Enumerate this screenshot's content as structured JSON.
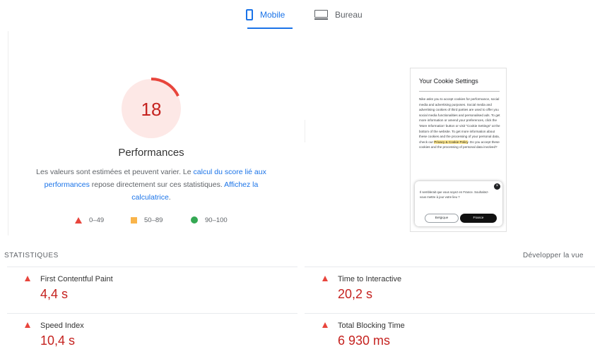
{
  "tabs": {
    "mobile": {
      "label": "Mobile",
      "icon": "phone-icon",
      "active": true
    },
    "desktop": {
      "label": "Bureau",
      "icon": "monitor-icon",
      "active": false
    }
  },
  "score": {
    "value": "18",
    "fraction": 0.18,
    "category": "Performances",
    "color": "#e8453c"
  },
  "description": {
    "part1": "Les valeurs sont estimées et peuvent varier. Le ",
    "link1": "calcul du score lié aux performances",
    "part2": " repose directement sur ces statistiques. ",
    "link2": "Affichez la calculatrice",
    "part3": "."
  },
  "legend": {
    "fail": "0–49",
    "average": "50–89",
    "pass": "90–100",
    "colors": {
      "fail": "#e8453c",
      "average": "#f9b44a",
      "pass": "#34a853"
    }
  },
  "screenshot": {
    "title": "Your Cookie Settings",
    "body_before_link": "Nike asks you to accept cookies for performance, social media and advertising purposes. Social media and advertising cookies of third parties are used to offer you social media functionalities and personalised ads. To get more information or amend your preferences, click the 'More Information' button or visit \"Cookie Settings\" at the bottom of the website. To get more information about these cookies and the processing of your personal data, check our ",
    "link": "Privacy & Cookie Policy",
    "body_after_link": ". Do you accept these cookies and the processing of personal data involved?",
    "popup_text": "Il semblerait que vous soyez en France. Souhaitez-vous mettre à jour votre lieu ?",
    "popup_close": "×",
    "popup_btn_outline": "Belgique",
    "popup_btn_solid": "France"
  },
  "stats": {
    "heading": "STATISTIQUES",
    "expand_label": "Développer la vue",
    "metrics": [
      {
        "name": "First Contentful Paint",
        "value": "4,4 s",
        "status": "fail"
      },
      {
        "name": "Time to Interactive",
        "value": "20,2 s",
        "status": "fail"
      },
      {
        "name": "Speed Index",
        "value": "10,4 s",
        "status": "fail"
      },
      {
        "name": "Total Blocking Time",
        "value": "6 930 ms",
        "status": "fail"
      }
    ]
  }
}
